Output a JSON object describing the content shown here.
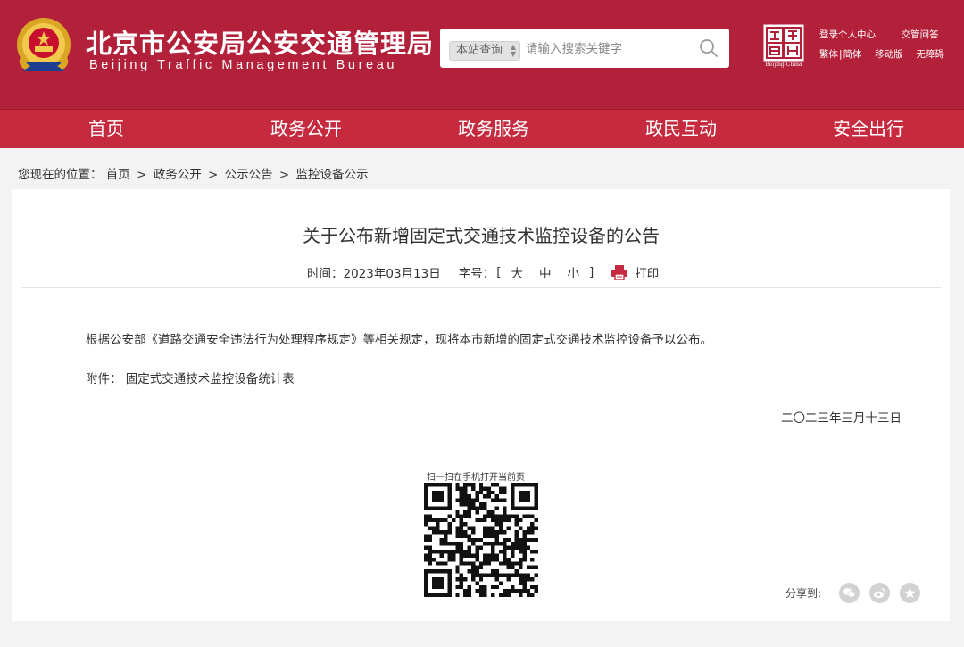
{
  "header": {
    "site_title": "北京市公安局公安交通管理局",
    "site_subtitle": "Beijing Traffic Management Bureau",
    "search": {
      "scope": "本站查询",
      "placeholder": "请输入搜索关键字"
    },
    "capital_logo_caption": "Beijing-China",
    "links": {
      "login": "登录个人中心",
      "faq": "交管问答",
      "traditional": "繁体",
      "separator": "|",
      "simplified": "简体",
      "mobile": "移动版",
      "accessible": "无障碍"
    }
  },
  "nav": {
    "items": [
      "首页",
      "政务公开",
      "政务服务",
      "政民互动",
      "安全出行"
    ]
  },
  "breadcrumb": {
    "prefix": "您现在的位置：",
    "items": [
      "首页",
      "政务公开",
      "公示公告",
      "监控设备公示"
    ],
    "separator": ">"
  },
  "article": {
    "title": "关于公布新增固定式交通技术监控设备的公告",
    "time_label": "时间：",
    "time_value": "2023年03月13日",
    "font_size_label": "字号：",
    "bracket_open": "[",
    "bracket_close": "]",
    "font_sizes": [
      "大",
      "中",
      "小"
    ],
    "print_label": "打印",
    "paragraph": "根据公安部《道路交通安全违法行为处理程序规定》等相关规定，现将本市新增的固定式交通技术监控设备予以公布。",
    "attachment_label": "附件：",
    "attachment_link": "固定式交通技术监控设备统计表",
    "sign_date": "二〇二三年三月十三日"
  },
  "qr": {
    "caption": "扫一扫在手机打开当前页"
  },
  "share": {
    "label": "分享到:",
    "targets": [
      "wechat-icon",
      "weibo-icon",
      "favorite-icon"
    ]
  },
  "colors": {
    "header_bg": "#b3203a",
    "nav_bg": "#c62a3f",
    "accent": "#c62a3f"
  }
}
